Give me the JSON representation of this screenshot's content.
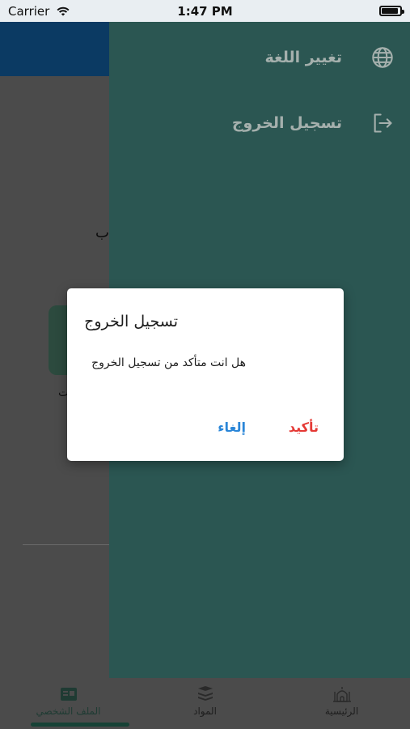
{
  "status_bar": {
    "carrier": "Carrier",
    "time": "1:47 PM"
  },
  "background": {
    "partial_text_1": "ب",
    "partial_text_2": "ت"
  },
  "drawer": {
    "items": [
      {
        "label": "تغيير اللغة",
        "icon": "globe-icon"
      },
      {
        "label": "تسجيل الخروج",
        "icon": "logout-icon"
      }
    ]
  },
  "dialog": {
    "title": "تسجيل الخروج",
    "message": "هل انت متأكد من تسجيل الخروج",
    "confirm_label": "تأكيد",
    "cancel_label": "إلغاء"
  },
  "bottom_nav": {
    "items": [
      {
        "label": "الرئيسية",
        "icon": "mosque-icon"
      },
      {
        "label": "المواد",
        "icon": "books-icon"
      },
      {
        "label": "الملف الشخصي",
        "icon": "profile-card-icon"
      }
    ],
    "active_index": 2
  },
  "colors": {
    "drawer_bg": "#2b5652",
    "confirm": "#e53935",
    "cancel": "#2a86d8",
    "header": "#0b3a63"
  }
}
